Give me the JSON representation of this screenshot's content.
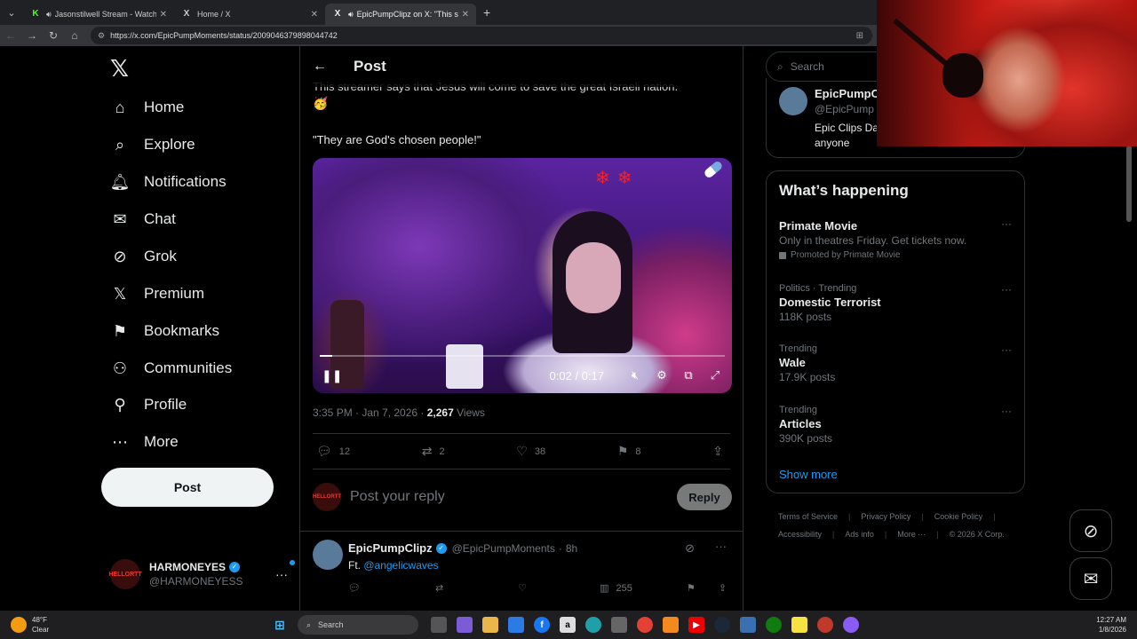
{
  "browser": {
    "tabs": [
      {
        "title": "Jasonstilwell Stream - Watch Li",
        "favicon": "K",
        "favicon_color": "#53fc18",
        "speaker": true
      },
      {
        "title": "Home / X",
        "favicon": "X",
        "favicon_color": "#ffffff",
        "speaker": false
      },
      {
        "title": "EpicPumpClipz on X: \"This str",
        "favicon": "X",
        "favicon_color": "#ffffff",
        "speaker": true
      }
    ],
    "url": "https://x.com/EpicPumpMoments/status/2009046379898044742"
  },
  "nav": {
    "items": [
      {
        "label": "Home",
        "icon": "home-icon",
        "glyph": "⌂"
      },
      {
        "label": "Explore",
        "icon": "search-icon",
        "glyph": "⌕"
      },
      {
        "label": "Notifications",
        "icon": "bell-icon",
        "glyph": "🔔︎"
      },
      {
        "label": "Chat",
        "icon": "mail-icon",
        "glyph": "✉"
      },
      {
        "label": "Grok",
        "icon": "grok-icon",
        "glyph": "⊘"
      },
      {
        "label": "Premium",
        "icon": "x-icon",
        "glyph": "𝕏"
      },
      {
        "label": "Bookmarks",
        "icon": "bookmark-icon",
        "glyph": "⚑"
      },
      {
        "label": "Communities",
        "icon": "people-icon",
        "glyph": "⚇"
      },
      {
        "label": "Profile",
        "icon": "person-icon",
        "glyph": "⚲"
      },
      {
        "label": "More",
        "icon": "more-circle-icon",
        "glyph": "⋯"
      }
    ],
    "post_label": "Post",
    "account": {
      "display_name": "HARMONEYES",
      "handle": "@HARMONEYESS",
      "avatar_text": "HELLORTT"
    }
  },
  "post": {
    "header_title": "Post",
    "text_line1": "This streamer says that Jesus will come to save the great Israeli nation.",
    "emoji": "🥳",
    "quote": "\"They are God's chosen people!\"",
    "video": {
      "time": "0:02 / 0:17",
      "progress": 0.03
    },
    "meta": {
      "time": "3:35 PM · Jan 7, 2026 · ",
      "views": "2,267",
      "views_label": " Views"
    },
    "actions": {
      "replies": "12",
      "reposts": "2",
      "likes": "38",
      "bookmarks": "8"
    },
    "reply_placeholder": "Post your reply",
    "reply_button": "Reply"
  },
  "reply_tweet": {
    "display_name": "EpicPumpClipz",
    "handle": "@EpicPumpMoments",
    "time": "8h",
    "text_prefix": "Ft. ",
    "mention": "@angelicwaves",
    "views": "255"
  },
  "right": {
    "search_placeholder": "Search",
    "profile_card": {
      "display_name": "EpicPumpCl",
      "handle": "@EpicPump",
      "bio": "Epic Clips Da anyone"
    },
    "happening_title": "What’s happening",
    "trends": [
      {
        "category": "",
        "name": "Primate Movie",
        "sub": "Only in theatres Friday. Get tickets now.",
        "promo": "Promoted by Primate Movie"
      },
      {
        "category": "Politics · Trending",
        "name": "Domestic Terrorist",
        "sub": "118K posts",
        "promo": ""
      },
      {
        "category": "Trending",
        "name": "Wale",
        "sub": "17.9K posts",
        "promo": ""
      },
      {
        "category": "Trending",
        "name": "Articles",
        "sub": "390K posts",
        "promo": ""
      }
    ],
    "show_more": "Show more",
    "footer": [
      "Terms of Service",
      "Privacy Policy",
      "Cookie Policy",
      "Accessibility",
      "Ads info",
      "More ···",
      "© 2026 X Corp."
    ]
  },
  "taskbar": {
    "weather_temp": "48°F",
    "weather_desc": "Clear",
    "search_label": "Search",
    "time": "12:27 AM",
    "date": "1/8/2026"
  },
  "colors": {
    "accent": "#1d9bf0",
    "background": "#000000",
    "border": "#2f3336",
    "muted": "#71767b"
  }
}
